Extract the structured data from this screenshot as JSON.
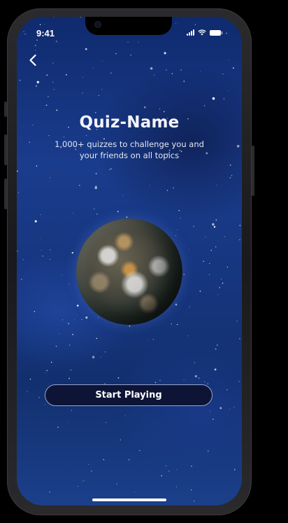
{
  "status_bar": {
    "time": "9:41",
    "icons": [
      "cellular-signal-icon",
      "wifi-icon",
      "battery-icon"
    ]
  },
  "nav": {
    "back_icon": "chevron-left-icon"
  },
  "hero": {
    "title": "Quiz-Name",
    "subtitle": "1,000+ quizzes to challenge you and your friends on all topics"
  },
  "actions": {
    "start_label": "Start Playing"
  },
  "colors": {
    "background": "#12306f",
    "button_bg": "#0d1436",
    "button_border": "#9aa4c8",
    "text": "#ffffff"
  }
}
